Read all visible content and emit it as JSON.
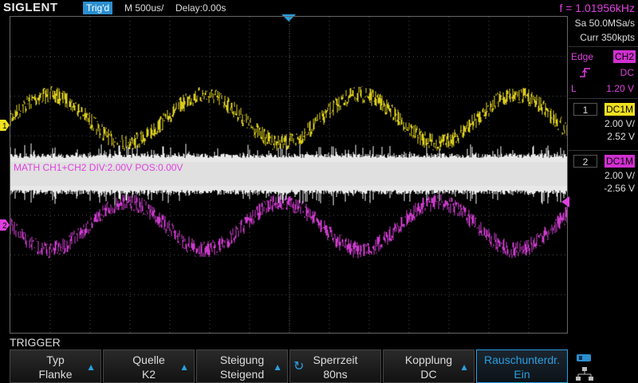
{
  "top": {
    "brand": "SIGLENT",
    "trig_state": "Trig'd",
    "timebase": "M 500us/",
    "delay": "Delay:0.00s",
    "frequency": "f = 1.01956kHz"
  },
  "acquisition": {
    "sample_rate": "Sa 50.0MSa/s",
    "memory": "Curr 350kpts"
  },
  "trigger_info": {
    "type": "Edge",
    "source": "CH2",
    "coupling": "DC",
    "level_label": "L",
    "level": "1.20 V"
  },
  "channels": [
    {
      "num": "1",
      "coupling": "DC1M",
      "scale": "2.00 V/",
      "offset": "2.52 V"
    },
    {
      "num": "2",
      "coupling": "DC1M",
      "scale": "2.00 V/",
      "offset": "-2.56 V"
    }
  ],
  "math_label": "MATH  CH1+CH2  DIV:2.00V  POS:0.00V",
  "markers": {
    "ch1": "1",
    "ch2": "2"
  },
  "menu": {
    "title": "TRIGGER",
    "keys": [
      {
        "line1": "Typ",
        "line2": "Flanke"
      },
      {
        "line1": "Quelle",
        "line2": "K2"
      },
      {
        "line1": "Steigung",
        "line2": "Steigend"
      },
      {
        "line1": "Sperrzeit",
        "line2": "80ns"
      },
      {
        "line1": "Kopplung",
        "line2": "DC"
      },
      {
        "line1": "Rauschunterdr.",
        "line2": "Ein"
      }
    ]
  },
  "colors": {
    "ch1": "#f0e020",
    "ch2": "#e040e0",
    "math": "#e8e8e8",
    "accent": "#2a8fd0"
  },
  "icons": [
    "trigger-arrow-icon",
    "rising-edge-icon",
    "usb-icon",
    "network-icon",
    "knob-icon"
  ]
}
